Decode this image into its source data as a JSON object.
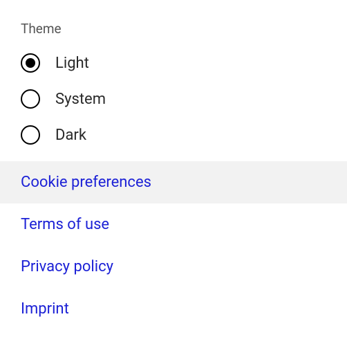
{
  "theme": {
    "label": "Theme",
    "options": [
      {
        "label": "Light",
        "selected": true
      },
      {
        "label": "System",
        "selected": false
      },
      {
        "label": "Dark",
        "selected": false
      }
    ]
  },
  "links": [
    {
      "label": "Cookie preferences",
      "highlighted": true
    },
    {
      "label": "Terms of use",
      "highlighted": false
    },
    {
      "label": "Privacy policy",
      "highlighted": false
    },
    {
      "label": "Imprint",
      "highlighted": false
    }
  ]
}
